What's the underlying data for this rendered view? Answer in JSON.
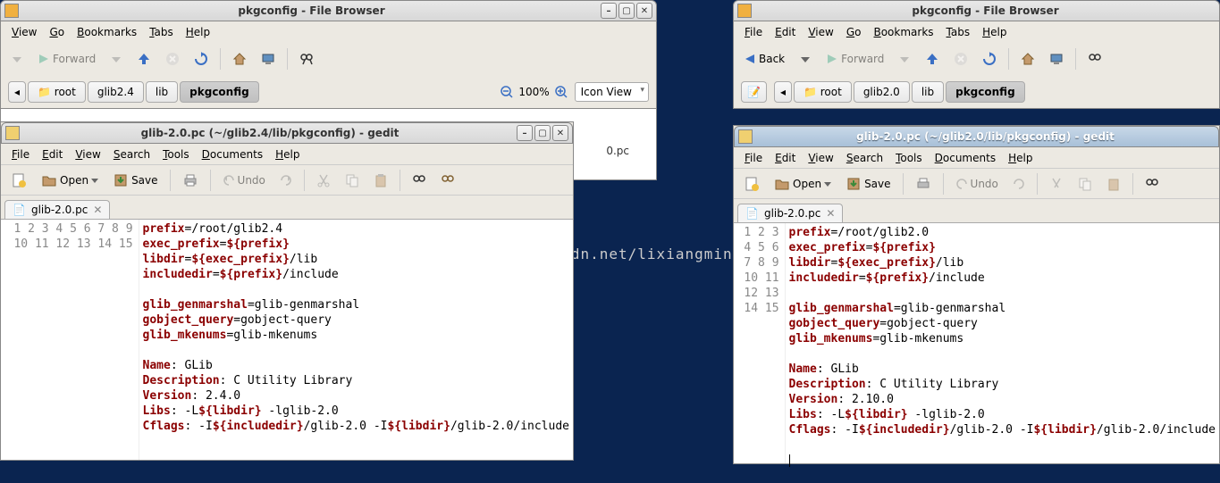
{
  "watermark": "http://blog.csdn.net/lixiangming",
  "left": {
    "fb": {
      "title": "pkgconfig - File Browser",
      "menus": [
        "View",
        "Go",
        "Bookmarks",
        "Tabs",
        "Help"
      ],
      "forward": "Forward",
      "crumbs": [
        "root",
        "glib2.4",
        "lib",
        "pkgconfig"
      ],
      "active_crumb": 3,
      "zoom": "100%",
      "view": "Icon View",
      "file_shown": "0.pc"
    },
    "gedit": {
      "title": "glib-2.0.pc (~/glib2.4/lib/pkgconfig) - gedit",
      "menus": [
        "File",
        "Edit",
        "View",
        "Search",
        "Tools",
        "Documents",
        "Help"
      ],
      "open": "Open",
      "save": "Save",
      "undo": "Undo",
      "tab": "glib-2.0.pc",
      "lines": [
        [
          [
            "kw",
            "prefix"
          ],
          [
            "",
            "=/root/glib2.4"
          ]
        ],
        [
          [
            "kw",
            "exec_prefix"
          ],
          [
            "",
            "="
          ],
          [
            "var",
            "${prefix}"
          ]
        ],
        [
          [
            "kw",
            "libdir"
          ],
          [
            "",
            "="
          ],
          [
            "var",
            "${exec_prefix}"
          ],
          [
            "",
            "/lib"
          ]
        ],
        [
          [
            "kw",
            "includedir"
          ],
          [
            "",
            "="
          ],
          [
            "var",
            "${prefix}"
          ],
          [
            "",
            "/include"
          ]
        ],
        [],
        [
          [
            "kw",
            "glib_genmarshal"
          ],
          [
            "",
            "=glib-genmarshal"
          ]
        ],
        [
          [
            "kw",
            "gobject_query"
          ],
          [
            "",
            "=gobject-query"
          ]
        ],
        [
          [
            "kw",
            "glib_mkenums"
          ],
          [
            "",
            "=glib-mkenums"
          ]
        ],
        [],
        [
          [
            "kw",
            "Name"
          ],
          [
            "",
            ": GLib"
          ]
        ],
        [
          [
            "kw",
            "Description"
          ],
          [
            "",
            ": C Utility Library"
          ]
        ],
        [
          [
            "kw",
            "Version"
          ],
          [
            "",
            ": 2.4.0"
          ]
        ],
        [
          [
            "kw",
            "Libs"
          ],
          [
            "",
            ": -L"
          ],
          [
            "var",
            "${libdir}"
          ],
          [
            "",
            " -lglib-2.0"
          ]
        ],
        [
          [
            "kw",
            "Cflags"
          ],
          [
            "",
            ": -I"
          ],
          [
            "var",
            "${includedir}"
          ],
          [
            "",
            "/glib-2.0 -I"
          ],
          [
            "var",
            "${libdir}"
          ],
          [
            "",
            "/glib-2.0/include"
          ]
        ],
        []
      ]
    }
  },
  "right": {
    "fb": {
      "title": "pkgconfig - File Browser",
      "menus": [
        "File",
        "Edit",
        "View",
        "Go",
        "Bookmarks",
        "Tabs",
        "Help"
      ],
      "back": "Back",
      "forward": "Forward",
      "crumbs": [
        "root",
        "glib2.0",
        "lib",
        "pkgconfig"
      ],
      "active_crumb": 3
    },
    "gedit": {
      "title": "glib-2.0.pc (~/glib2.0/lib/pkgconfig) - gedit",
      "menus": [
        "File",
        "Edit",
        "View",
        "Search",
        "Tools",
        "Documents",
        "Help"
      ],
      "open": "Open",
      "save": "Save",
      "undo": "Undo",
      "tab": "glib-2.0.pc",
      "lines": [
        [
          [
            "kw",
            "prefix"
          ],
          [
            "",
            "=/root/glib2.0"
          ]
        ],
        [
          [
            "kw",
            "exec_prefix"
          ],
          [
            "",
            "="
          ],
          [
            "var",
            "${prefix}"
          ]
        ],
        [
          [
            "kw",
            "libdir"
          ],
          [
            "",
            "="
          ],
          [
            "var",
            "${exec_prefix}"
          ],
          [
            "",
            "/lib"
          ]
        ],
        [
          [
            "kw",
            "includedir"
          ],
          [
            "",
            "="
          ],
          [
            "var",
            "${prefix}"
          ],
          [
            "",
            "/include"
          ]
        ],
        [],
        [
          [
            "kw",
            "glib_genmarshal"
          ],
          [
            "",
            "=glib-genmarshal"
          ]
        ],
        [
          [
            "kw",
            "gobject_query"
          ],
          [
            "",
            "=gobject-query"
          ]
        ],
        [
          [
            "kw",
            "glib_mkenums"
          ],
          [
            "",
            "=glib-mkenums"
          ]
        ],
        [],
        [
          [
            "kw",
            "Name"
          ],
          [
            "",
            ": GLib"
          ]
        ],
        [
          [
            "kw",
            "Description"
          ],
          [
            "",
            ": C Utility Library"
          ]
        ],
        [
          [
            "kw",
            "Version"
          ],
          [
            "",
            ": 2.10.0"
          ]
        ],
        [
          [
            "kw",
            "Libs"
          ],
          [
            "",
            ": -L"
          ],
          [
            "var",
            "${libdir}"
          ],
          [
            "",
            " -lglib-2.0"
          ]
        ],
        [
          [
            "kw",
            "Cflags"
          ],
          [
            "",
            ": -I"
          ],
          [
            "var",
            "${includedir}"
          ],
          [
            "",
            "/glib-2.0 -I"
          ],
          [
            "var",
            "${libdir}"
          ],
          [
            "",
            "/glib-2.0/include"
          ]
        ],
        []
      ]
    }
  }
}
